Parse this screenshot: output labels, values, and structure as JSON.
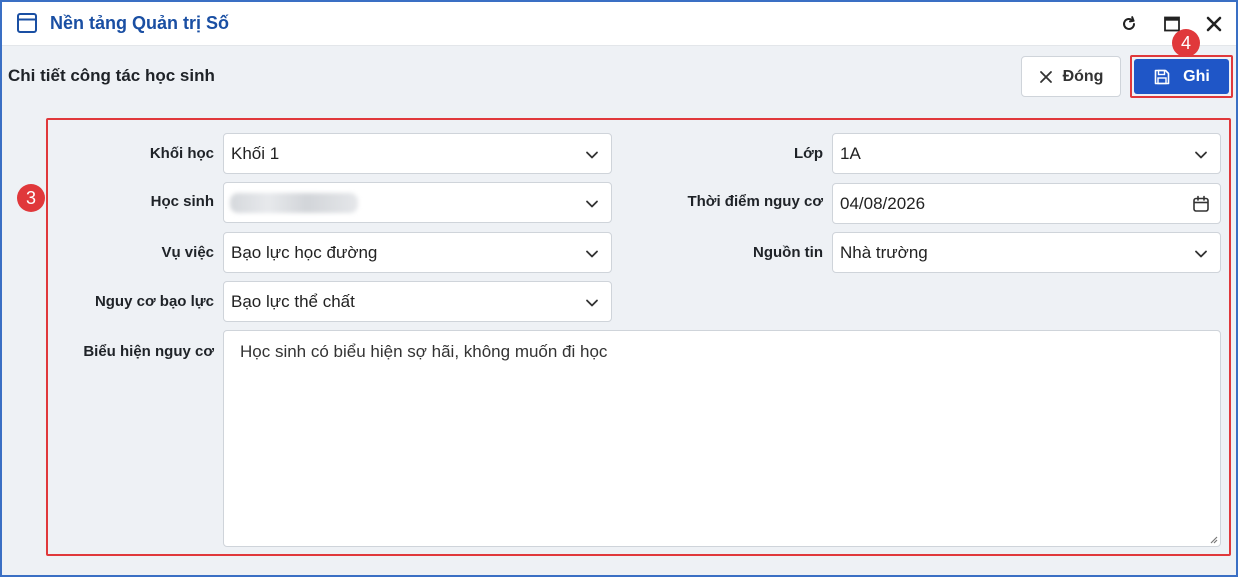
{
  "window": {
    "title": "Nền tảng Quản trị Số",
    "app_icon": "window-icon",
    "controls": [
      "refresh-icon",
      "maximize-icon",
      "close-icon"
    ]
  },
  "header": {
    "title": "Chi tiết công tác học sinh",
    "close_label": "Đóng",
    "save_label": "Ghi"
  },
  "annotations": {
    "save_step": "4",
    "form_step": "3"
  },
  "form": {
    "grade": {
      "label": "Khối học",
      "value": "Khối 1"
    },
    "class": {
      "label": "Lớp",
      "value": "1A"
    },
    "student": {
      "label": "Học sinh",
      "value": ""
    },
    "risk_time": {
      "label": "Thời điểm nguy cơ",
      "value": "04/08/2026"
    },
    "incident": {
      "label": "Vụ việc",
      "value": "Bạo lực học đường"
    },
    "source": {
      "label": "Nguồn tin",
      "value": "Nhà trường"
    },
    "violence_risk": {
      "label": "Nguy cơ bạo lực",
      "value": "Bạo lực thể chất"
    },
    "risk_signs": {
      "label": "Biểu hiện nguy cơ",
      "value": "Học sinh có biểu hiện sợ hãi, không muốn đi học"
    }
  },
  "colors": {
    "accent": "#1f56c7",
    "title": "#1a4fa3",
    "highlight": "#e0383b",
    "window_border": "#3a6fc4"
  }
}
